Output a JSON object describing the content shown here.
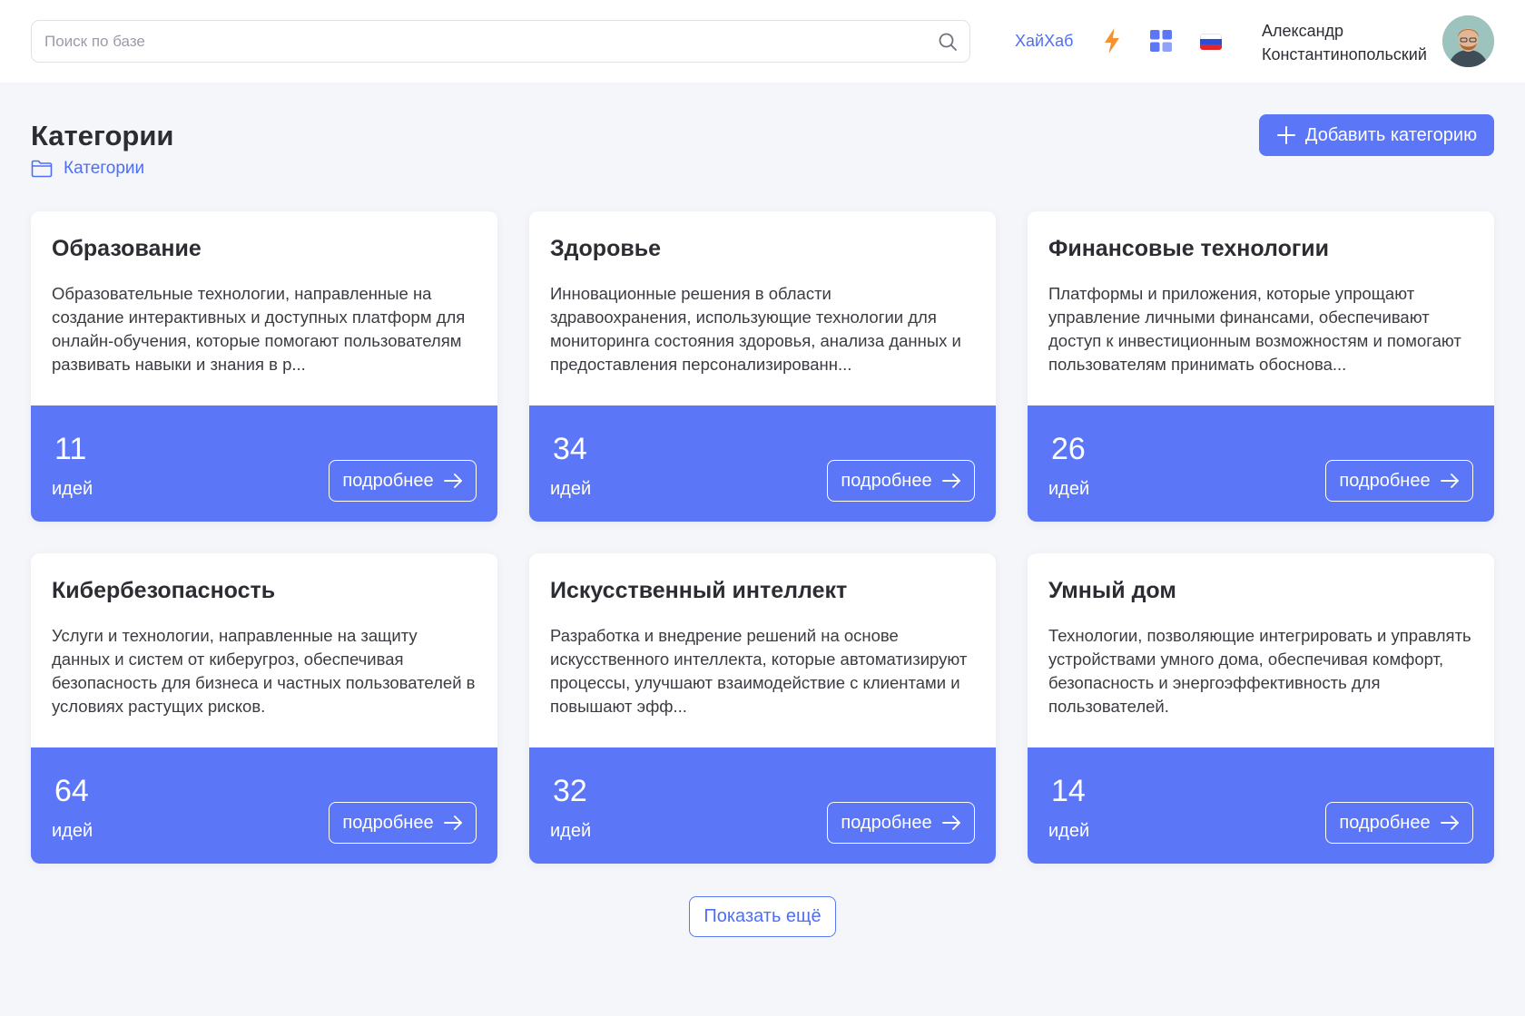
{
  "header": {
    "search": {
      "placeholder": "Поиск по базе",
      "value": ""
    },
    "brand_link": "ХайХаб",
    "icons": [
      "search-icon",
      "bolt-icon",
      "apps-grid-icon",
      "flag-ru-icon"
    ],
    "user": {
      "first_name": "Александр",
      "last_name": "Константинопольский"
    }
  },
  "page": {
    "title": "Категории",
    "breadcrumb": "Категории",
    "add_button_label": "Добавить категорию"
  },
  "categories": [
    {
      "title": "Образование",
      "description": "Образовательные технологии, направленные на создание интерактивных и доступных платформ для онлайн-обучения, которые помогают пользователям развивать навыки и знания в р...",
      "count": "11",
      "count_label": "идей",
      "button_label": "подробнее"
    },
    {
      "title": "Здоровье",
      "description": "Инновационные решения в области здравоохранения, использующие технологии для мониторинга состояния здоровья, анализа данных и предоставления персонализированн...",
      "count": "34",
      "count_label": "идей",
      "button_label": "подробнее"
    },
    {
      "title": "Финансовые технологии",
      "description": "Платформы и приложения, которые упрощают управление личными финансами, обеспечивают доступ к инвестиционным возможностям и помогают пользователям принимать обоснова...",
      "count": "26",
      "count_label": "идей",
      "button_label": "подробнее"
    },
    {
      "title": "Кибербезопасность",
      "description": "Услуги и технологии, направленные на защиту данных и систем от киберугроз, обеспечивая безопасность для бизнеса и частных пользователей в условиях растущих рисков.",
      "count": "64",
      "count_label": "идей",
      "button_label": "подробнее"
    },
    {
      "title": "Искусственный интеллект",
      "description": "Разработка и внедрение решений на основе искусственного интеллекта, которые автоматизируют процессы, улучшают взаимодействие с клиентами и повышают эфф...",
      "count": "32",
      "count_label": "идей",
      "button_label": "подробнее"
    },
    {
      "title": "Умный дом",
      "description": "Технологии, позволяющие интегрировать и управлять устройствами умного дома, обеспечивая комфорт, безопасность и энергоэффективность для пользователей.",
      "count": "14",
      "count_label": "идей",
      "button_label": "подробнее"
    }
  ],
  "show_more_label": "Показать ещё",
  "colors": {
    "accent": "#5b76f7",
    "link": "#4f6ef7",
    "background": "#f5f6fa",
    "bolt": "#f5922e"
  }
}
